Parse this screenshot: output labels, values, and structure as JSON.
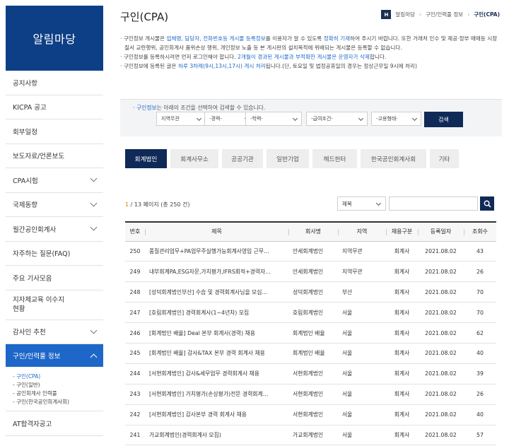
{
  "sidebar": {
    "title": "알림마당",
    "items": [
      {
        "label": "공지사항",
        "chev": false
      },
      {
        "label": "KICPA 공고",
        "chev": false
      },
      {
        "label": "회부일정",
        "chev": false
      },
      {
        "label": "보도자료/언론보도",
        "chev": false
      },
      {
        "label": "CPA시험",
        "chev": true
      },
      {
        "label": "국제동향",
        "chev": true
      },
      {
        "label": "월간공인회계사",
        "chev": true
      },
      {
        "label": "자주하는 질문(FAQ)",
        "chev": false
      },
      {
        "label": "주요 기사모음",
        "chev": false
      },
      {
        "label": "지자체교육 이수지현황",
        "chev": false
      },
      {
        "label": "감사인 추천",
        "chev": true
      }
    ],
    "active_label": "구인/인력풀 정보",
    "sub_items": [
      "- 구인(CPA)",
      "- 구인(일반)",
      "- 공인회계사 인력풀",
      "- 구인(한국공인회계사회)"
    ],
    "after_label": "AT합격자공고"
  },
  "header": {
    "title": "구인(CPA)",
    "home_icon_text": "H",
    "breadcrumb": [
      "알림마당",
      "구인/인력풀 정보",
      "구인(CPA)"
    ]
  },
  "notice": {
    "l1a": "· 구인정보 게시물은 ",
    "l1b": "업체명, 담당자, 전화번호등 게시물 등록정보",
    "l1c": "를 이용자가 알 수 있도록 ",
    "l1d": "정확히 기재",
    "l1e": "하여 주시기 바랍니다. 또한 거래처 인수 및 제공·정부 매매등 시장질서 교란행위, 공인회계사 품위손상 행위, 개인정보 노출 등 본 게시판의 설치목적에 위배되는 게시물은 등록할 수 없습니다.",
    "l2a": "· 구인정보를 등록하시려면 먼저 로그인해야 합니다. ",
    "l2b": "2개월이 경과된 게시물과 부적확한 게시물은 운영자가 삭제",
    "l2c": "합니다.",
    "l3a": "· 구인정보에 등록된 글은 ",
    "l3b": "하루 3차례(9시,13시,17시) 게시 처리",
    "l3c": "됩니다.(단, 토요일 및 법정공휴일의 경우는 정상근무일 9시에 처리)"
  },
  "search": {
    "hint_a": "구인정보",
    "hint_b": "는 아래의 조건을 선택하여 검색할 수 있습니다.",
    "selects": [
      "지역무관",
      "-경력-",
      "-학력-",
      "-급여조건-",
      "-고용형태-"
    ],
    "button": "검색"
  },
  "tabs": [
    "회계법인",
    "회계사무소",
    "공공기관",
    "일반기업",
    "헤드헌터",
    "한국공인회계사회",
    "기타"
  ],
  "list": {
    "page_current": "1",
    "page_rest": " / 13 페이지  (총 250 건)",
    "filter_value": "제목",
    "search_icon": "magnifier-icon",
    "columns": [
      "번호",
      "제목",
      "회사명",
      "지역",
      "채용구분",
      "등록일자",
      "조회수"
    ],
    "rows": [
      [
        "250",
        "품질관리업무+PA업무주실행가능회계사영입 근무…",
        "안세회계법인",
        "지역무관",
        "회계사",
        "2021.08.02",
        "43"
      ],
      [
        "249",
        "내부회계PA,ESG자문,가치평가,IFRS회적+경력자…",
        "안세회계법인",
        "지역무관",
        "회계사",
        "2021.08.02",
        "26"
      ],
      [
        "248",
        "[성덕회계법인부산] 수습 및 경력회계사님을 모십…",
        "성덕회계법인",
        "부산",
        "회계사",
        "2021.08.02",
        "70"
      ],
      [
        "247",
        "[호림회계법인] 경력회계사(1~4년차) 모집",
        "호림회계법인",
        "서울",
        "회계사",
        "2021.08.02",
        "70"
      ],
      [
        "246",
        "[회계법인 배율] Deal 본부 회계사(경력) 채용",
        "회계법인 배율",
        "서울",
        "회계사",
        "2021.08.02",
        "62"
      ],
      [
        "245",
        "[회계법인 배율] 감사&TAX 본부 경력 회계사 채용",
        "회계법인 배율",
        "서울",
        "회계사",
        "2021.08.02",
        "40"
      ],
      [
        "244",
        "[서현회계법인] 감사&세무업무 경력회계사 채용",
        "서현회계법인",
        "서울",
        "회계사",
        "2021.08.02",
        "39"
      ],
      [
        "243",
        "[서현회계법인] 가치평가(손상평가)전문 경력회계…",
        "서현회계법인",
        "서울",
        "회계사",
        "2021.08.02",
        "26"
      ],
      [
        "242",
        "[서현회계법인] 감사본부 경력 회계사 채용",
        "서현회계법인",
        "서울",
        "회계사",
        "2021.08.02",
        "40"
      ],
      [
        "241",
        "가교회계법인(경력회계사 모집)",
        "가교회계법인",
        "서울",
        "회계사",
        "2021.08.02",
        "57"
      ]
    ]
  }
}
